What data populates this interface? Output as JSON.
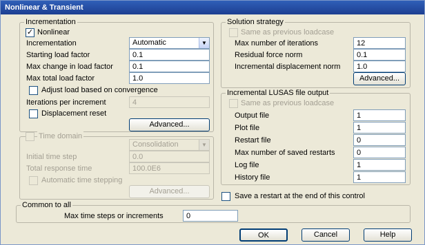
{
  "window": {
    "title": "Nonlinear & Transient"
  },
  "incrementation": {
    "legend": "Incrementation",
    "nonlinear_label": "Nonlinear",
    "incrementation_label": "Incrementation",
    "incrementation_value": "Automatic",
    "starting_load_factor_label": "Starting load factor",
    "starting_load_factor_value": "0.1",
    "max_change_label": "Max change in load factor",
    "max_change_value": "0.1",
    "max_total_label": "Max total load factor",
    "max_total_value": "1.0",
    "adjust_label": "Adjust load based on convergence",
    "iterations_label": "Iterations per increment",
    "iterations_value": "4",
    "displacement_reset_label": "Displacement reset",
    "advanced_label": "Advanced..."
  },
  "time_domain": {
    "label": "Time domain",
    "type_value": "Consolidation",
    "initial_step_label": "Initial time step",
    "initial_step_value": "0.0",
    "total_response_label": "Total response time",
    "total_response_value": "100.0E6",
    "auto_stepping_label": "Automatic time stepping",
    "advanced_label": "Advanced..."
  },
  "solution_strategy": {
    "legend": "Solution strategy",
    "same_as_previous_label": "Same as previous loadcase",
    "max_iterations_label": "Max number of iterations",
    "max_iterations_value": "12",
    "residual_force_label": "Residual force norm",
    "residual_force_value": "0.1",
    "incremental_disp_label": "Incremental displacement norm",
    "incremental_disp_value": "1.0",
    "advanced_label": "Advanced..."
  },
  "file_output": {
    "legend": "Incremental LUSAS file output",
    "same_as_previous_label": "Same as previous loadcase",
    "output_file_label": "Output file",
    "output_file_value": "1",
    "plot_file_label": "Plot file",
    "plot_file_value": "1",
    "restart_file_label": "Restart file",
    "restart_file_value": "0",
    "max_saved_restarts_label": "Max number of saved restarts",
    "max_saved_restarts_value": "0",
    "log_file_label": "Log file",
    "log_file_value": "1",
    "history_file_label": "History file",
    "history_file_value": "1"
  },
  "save_restart_label": "Save a restart at the end of this control",
  "common": {
    "legend": "Common to all",
    "max_steps_label": "Max time steps or increments",
    "max_steps_value": "0"
  },
  "buttons": {
    "ok": "OK",
    "cancel": "Cancel",
    "help": "Help"
  }
}
